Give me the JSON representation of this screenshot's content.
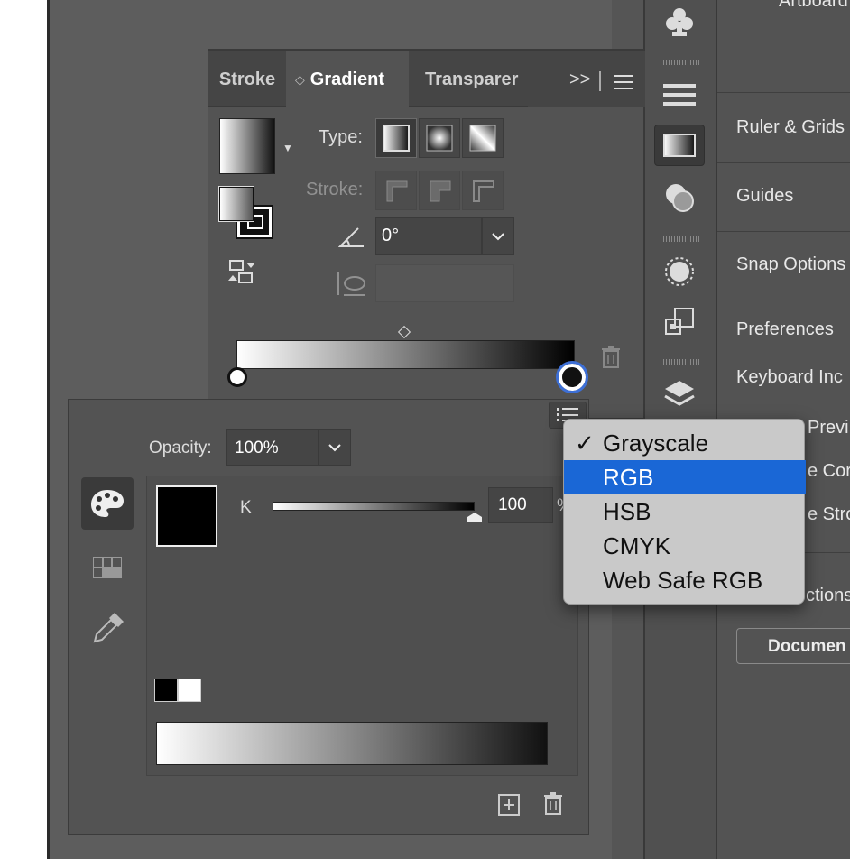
{
  "right_panel": {
    "items": [
      "Artboard",
      "Ruler & Grids",
      "Guides",
      "Snap Options",
      "Preferences",
      "Keyboard Inc",
      "Previ",
      "e Cor",
      "e Stro",
      "ctions"
    ],
    "document_button": "Documen"
  },
  "gradient_panel": {
    "tabs": [
      "Stroke",
      "Gradient",
      "Transparer"
    ],
    "overflow": ">>",
    "type_label": "Type:",
    "stroke_label": "Stroke:",
    "angle_value": "0°",
    "aspect_value": ""
  },
  "color_panel": {
    "opacity_label": "Opacity:",
    "opacity_value": "100%",
    "k_label": "K",
    "k_value": "100",
    "k_unit": "%",
    "k_level": 1.0
  },
  "menu": {
    "items": [
      "Grayscale",
      "RGB",
      "HSB",
      "CMYK",
      "Web Safe RGB"
    ],
    "checked": "Grayscale",
    "highlighted": "RGB",
    "check_mark": "✓"
  },
  "colors": {
    "panel_bg": "#535353",
    "tab_bar": "#454545",
    "menu_highlight": "#1a67d6",
    "stop_ring": "#3d6fd6"
  }
}
